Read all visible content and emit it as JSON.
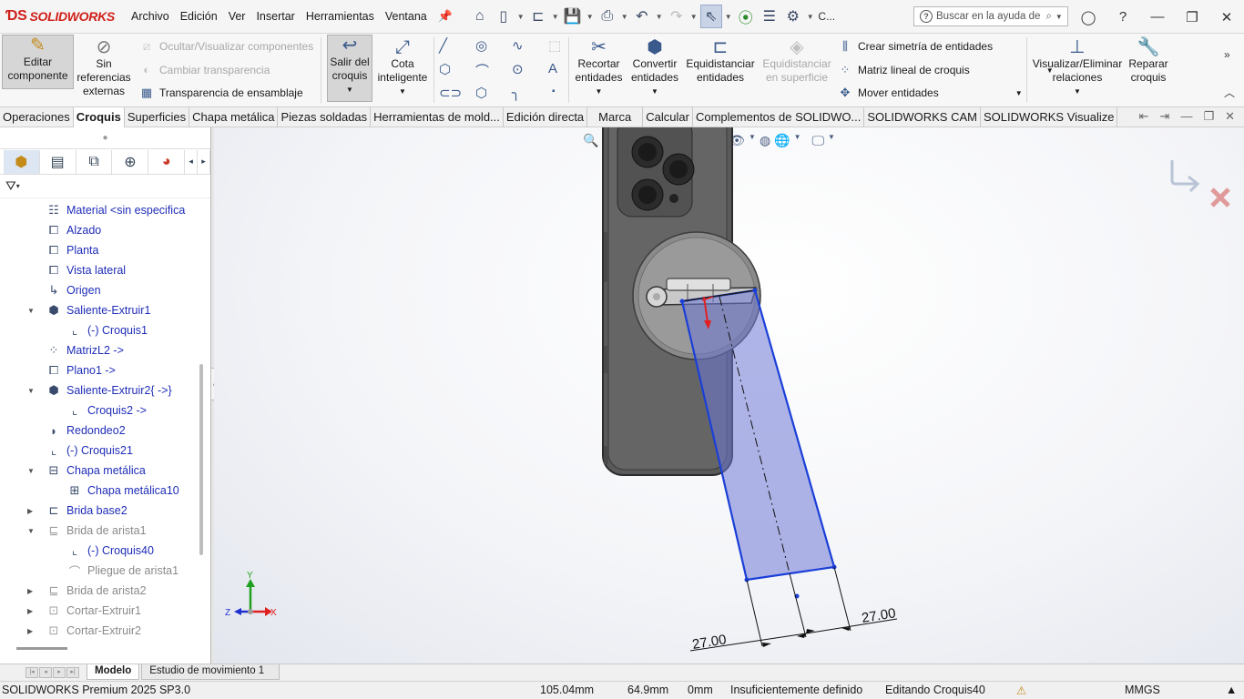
{
  "app": {
    "brand": "SOLIDWORKS",
    "menu": [
      "Archivo",
      "Edición",
      "Ver",
      "Insertar",
      "Herramientas",
      "Ventana"
    ],
    "search_placeholder": "Buscar en la ayuda de",
    "quick_label": "C..."
  },
  "ribbon": {
    "editar_componente": [
      "Editar",
      "componente"
    ],
    "sin_referencias": [
      "Sin",
      "referencias",
      "externas"
    ],
    "ocultar": "Ocultar/Visualizar componentes",
    "cambiar_transparencia": "Cambiar transparencia",
    "transparencia_ensamblaje": "Transparencia de ensamblaje",
    "salir_croquis": [
      "Salir del",
      "croquis"
    ],
    "cota": [
      "Cota",
      "inteligente"
    ],
    "recortar": [
      "Recortar",
      "entidades"
    ],
    "convertir": [
      "Convertir",
      "entidades"
    ],
    "equidistanciar": [
      "Equidistanciar",
      "entidades"
    ],
    "equidistanciar_sup": [
      "Equidistanciar",
      "en superficie"
    ],
    "simetria": "Crear simetría de entidades",
    "matriz": "Matriz lineal de croquis",
    "mover": "Mover entidades",
    "visualizar": [
      "Visualizar/Eliminar",
      "relaciones"
    ],
    "reparar": [
      "Reparar",
      "croquis"
    ]
  },
  "tabs": [
    "Operaciones",
    "Croquis",
    "Superficies",
    "Chapa metálica",
    "Piezas soldadas",
    "Herramientas de mold...",
    "Edición directa",
    "Marca",
    "Calcular",
    "Complementos de SOLIDWO...",
    "SOLIDWORKS CAM",
    "SOLIDWORKS Visualize"
  ],
  "active_tab": "Croquis",
  "tree": [
    {
      "label": "Material <sin especifica",
      "icon": "material-icon",
      "level": 0,
      "exp": "",
      "gray": false
    },
    {
      "label": "Alzado",
      "icon": "plane-icon",
      "level": 0,
      "exp": "",
      "gray": false
    },
    {
      "label": "Planta",
      "icon": "plane-icon",
      "level": 0,
      "exp": "",
      "gray": false
    },
    {
      "label": "Vista lateral",
      "icon": "plane-icon",
      "level": 0,
      "exp": "",
      "gray": false
    },
    {
      "label": "Origen",
      "icon": "origin-icon",
      "level": 0,
      "exp": "",
      "gray": false
    },
    {
      "label": "Saliente-Extruir1",
      "icon": "extrude-icon",
      "level": 0,
      "exp": "▼",
      "gray": false
    },
    {
      "label": "(-) Croquis1",
      "icon": "sketch-icon",
      "level": 1,
      "exp": "",
      "gray": false
    },
    {
      "label": "MatrizL2 ->",
      "icon": "pattern-icon",
      "level": 0,
      "exp": "",
      "gray": false
    },
    {
      "label": "Plano1 ->",
      "icon": "plane-icon",
      "level": 0,
      "exp": "",
      "gray": false
    },
    {
      "label": "Saliente-Extruir2{ ->}",
      "icon": "extrude-icon",
      "level": 0,
      "exp": "▼",
      "gray": false
    },
    {
      "label": "Croquis2 ->",
      "icon": "sketch-icon",
      "level": 1,
      "exp": "",
      "gray": false
    },
    {
      "label": "Redondeo2",
      "icon": "fillet-icon",
      "level": 0,
      "exp": "",
      "gray": false
    },
    {
      "label": "(-) Croquis21",
      "icon": "sketch-icon",
      "level": 0,
      "exp": "",
      "gray": false
    },
    {
      "label": "Chapa metálica",
      "icon": "sheetmetal-icon",
      "level": 0,
      "exp": "▼",
      "gray": false
    },
    {
      "label": "Chapa metálica10",
      "icon": "sheetmetal-feature-icon",
      "level": 1,
      "exp": "",
      "gray": false
    },
    {
      "label": "Brida base2",
      "icon": "base-flange-icon",
      "level": 0,
      "exp": "▶",
      "gray": false
    },
    {
      "label": "Brida de arista1",
      "icon": "edge-flange-icon",
      "level": 0,
      "exp": "▼",
      "gray": true
    },
    {
      "label": "(-) Croquis40",
      "icon": "sketch-icon",
      "level": 1,
      "exp": "",
      "gray": false
    },
    {
      "label": "Pliegue de arista1",
      "icon": "bend-icon",
      "level": 1,
      "exp": "",
      "gray": true
    },
    {
      "label": "Brida de arista2",
      "icon": "edge-flange-icon",
      "level": 0,
      "exp": "▶",
      "gray": true
    },
    {
      "label": "Cortar-Extruir1",
      "icon": "cut-icon",
      "level": 0,
      "exp": "▶",
      "gray": true
    },
    {
      "label": "Cortar-Extruir2",
      "icon": "cut-icon",
      "level": 0,
      "exp": "▶",
      "gray": true
    }
  ],
  "viewport": {
    "dim_left": "27.00",
    "dim_right": "27.00",
    "triad": {
      "y": "Y",
      "z": "Z",
      "x": "X"
    }
  },
  "bottom_tabs": [
    "Modelo",
    "Estudio de movimiento 1"
  ],
  "status": {
    "product": "SOLIDWORKS Premium 2025 SP3.0",
    "x": "105.04mm",
    "y": "64.9mm",
    "z": "0mm",
    "state": "Insuficientemente definido",
    "editing": "Editando Croquis40",
    "units": "MMGS"
  },
  "colors": {
    "brand": "#d0201a",
    "sketch_blue": "#1a3fd8",
    "flange_fill": "#9aa2e0"
  }
}
